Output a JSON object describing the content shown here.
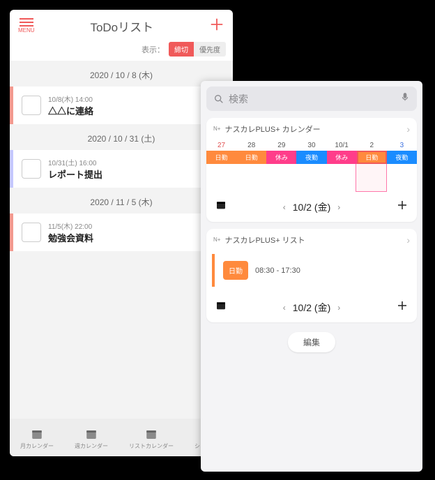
{
  "left": {
    "menu_label": "MENU",
    "title": "ToDoリスト",
    "display_label": "表示：",
    "seg_active": "締切",
    "seg_inactive": "優先度",
    "groups": [
      {
        "date": "2020 / 10 / 8 (木)",
        "meta": "10/8(木) 14:00",
        "title": "△△に連絡",
        "alt": false
      },
      {
        "date": "2020 / 10 / 31 (土)",
        "meta": "10/31(土) 16:00",
        "title": "レポート提出",
        "alt": true
      },
      {
        "date": "2020 / 11 / 5 (木)",
        "meta": "11/5(木) 22:00",
        "title": "勉強会資料",
        "alt": false
      }
    ],
    "tabs": [
      "月カレンダー",
      "週カレンダー",
      "リストカレンダー",
      "シフト共有"
    ]
  },
  "right": {
    "search_placeholder": "検索",
    "calendar_card_title": "ナスカレPLUS+ カレンダー",
    "list_card_title": "ナスカレPLUS+ リスト",
    "week_nums": [
      "27",
      "28",
      "29",
      "30",
      "10/1",
      "2",
      "3"
    ],
    "week_classes": [
      "sun",
      "",
      "",
      "",
      "",
      "",
      "sat"
    ],
    "shifts": [
      {
        "label": "日勤",
        "cls": "s-or"
      },
      {
        "label": "日勤",
        "cls": "s-or"
      },
      {
        "label": "休み",
        "cls": "s-pk"
      },
      {
        "label": "夜勤",
        "cls": "s-bl"
      },
      {
        "label": "休み",
        "cls": "s-pk"
      },
      {
        "label": "日勤",
        "cls": "s-or"
      },
      {
        "label": "夜勤",
        "cls": "s-bl"
      }
    ],
    "selected_index": 5,
    "nav_date": "10/2 (金)",
    "list_badge": "日勤",
    "list_time": "08:30 - 17:30",
    "edit_label": "編集"
  }
}
